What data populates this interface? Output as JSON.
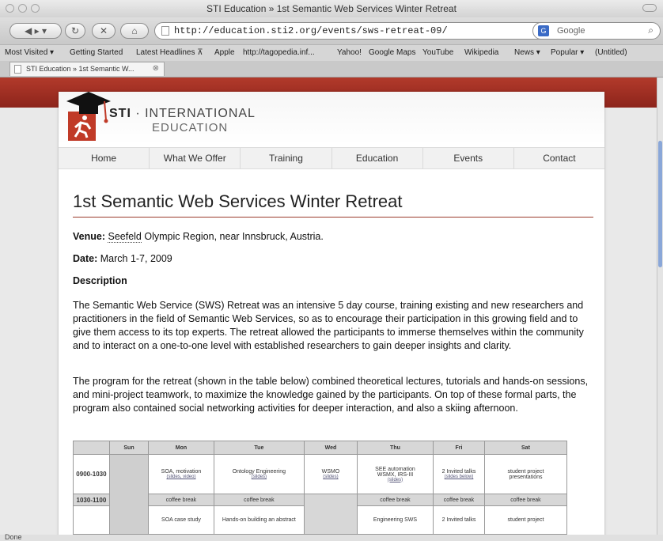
{
  "window": {
    "title": "STI Education » 1st Semantic Web Services Winter Retreat"
  },
  "toolbar": {
    "url": "http://education.sti2.org/events/sws-retreat-09/",
    "search_placeholder": "Google"
  },
  "bookmarks": [
    "Most Visited ▾",
    "Getting Started",
    "Latest Headlines ⊼",
    "Apple",
    "http://tagopedia.inf...",
    "Yahoo!",
    "Google Maps",
    "YouTube",
    "Wikipedia",
    "News ▾",
    "Popular ▾",
    "(Untitled)"
  ],
  "tab": {
    "label": "STI Education » 1st Semantic W..."
  },
  "site": {
    "brand_main": "STI",
    "brand_sep": " · INTERNATIONAL",
    "brand_sub": "EDUCATION",
    "menu": [
      "Home",
      "What We Offer",
      "Training",
      "Education",
      "Events",
      "Contact"
    ]
  },
  "content": {
    "title": "1st Semantic Web Services Winter Retreat",
    "venue_label": "Venue:",
    "venue_link": "Seefeld",
    "venue_rest": " Olympic Region, near Innsbruck, Austria.",
    "date_label": "Date:",
    "date_value": " March 1-7, 2009",
    "description_heading": "Description",
    "para1": "The Semantic Web Service (SWS) Retreat was an intensive 5 day course, training existing and new researchers and practitioners in the field of Semantic Web Services, so as to encourage their participation in this growing field and to give them access to its top experts. The retreat allowed the participants to immerse themselves within the community and to interact on a one-to-one level with established researchers to gain deeper insights and clarity.",
    "para2": "The program for the retreat (shown in the table below) combined theoretical lectures, tutorials and hands-on sessions, and mini-project teamwork, to maximize the knowledge gained by the participants. On top of these formal parts, the program also contained social networking activities for deeper interaction, and also a skiing afternoon."
  },
  "schedule": {
    "headers": [
      "",
      "Sun",
      "Mon",
      "Tue",
      "Wed",
      "Thu",
      "Fri",
      "Sat"
    ],
    "row1": {
      "time": "0900-1030",
      "mon": "SOA, motivation",
      "mon_sub": "(slides, video)",
      "tue": "Ontology Engineering",
      "tue_sub": "(slides)",
      "wed": "WSMO",
      "wed_sub": "(slides)",
      "thu": "SEE automation",
      "thu2": "WSMX, IRS-III",
      "thu_sub": "(slides)",
      "fri": "2 Invited talks",
      "fri_sub": "(slides below)",
      "sat": "student project",
      "sat2": "presentations"
    },
    "break": {
      "time": "1030-1100",
      "label": "coffee break"
    },
    "row2": {
      "mon": "SOA case study",
      "tue": "Hands-on building an abstract",
      "thu": "Engineering SWS",
      "fri": "2 Invited talks",
      "sat": "student project"
    }
  },
  "status": {
    "text": "Done"
  }
}
